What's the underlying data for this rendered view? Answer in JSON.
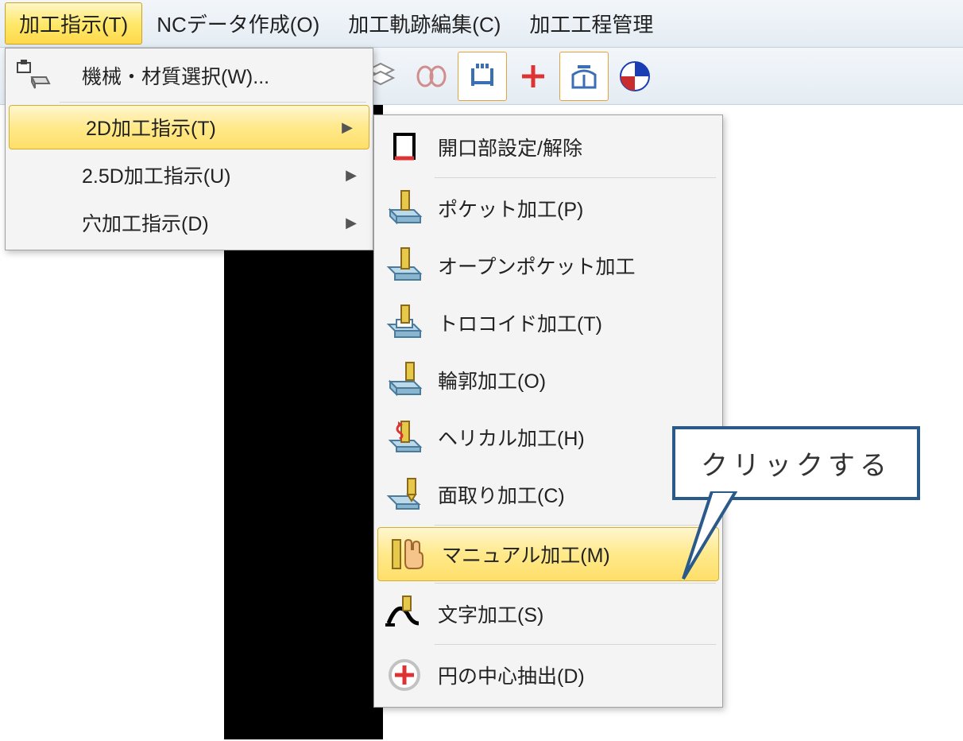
{
  "menubar": {
    "items": [
      {
        "label": "加工指示(T)",
        "accel": "T",
        "highlighted": true
      },
      {
        "label": "NCデータ作成(O)",
        "accel": "O"
      },
      {
        "label": "加工軌跡編集(C)",
        "accel": "C"
      },
      {
        "label": "加工工程管理",
        "accel": ""
      }
    ]
  },
  "toolbar": {
    "icons": [
      "layers",
      "coupling",
      "span-measure",
      "plus",
      "align-center",
      "target-bluered"
    ]
  },
  "dropdown": {
    "items": [
      {
        "label": "機械・材質選択(W)...",
        "accel": "W",
        "icon": "machine-material",
        "has_submenu": false
      },
      {
        "label": "2D加工指示(T)",
        "accel": "T",
        "icon": "",
        "has_submenu": true,
        "highlighted": true
      },
      {
        "label": "2.5D加工指示(U)",
        "accel": "U",
        "icon": "",
        "has_submenu": true
      },
      {
        "label": "穴加工指示(D)",
        "accel": "D",
        "icon": "",
        "has_submenu": true
      }
    ]
  },
  "submenu": {
    "items": [
      {
        "label": "開口部設定/解除",
        "accel": "",
        "icon": "opening"
      },
      {
        "label": "ポケット加工(P)",
        "accel": "P",
        "icon": "pocket"
      },
      {
        "label": "オープンポケット加工",
        "accel": "",
        "icon": "open-pocket"
      },
      {
        "label": "トロコイド加工(T)",
        "accel": "T",
        "icon": "trochoid"
      },
      {
        "label": "輪郭加工(O)",
        "accel": "O",
        "icon": "contour"
      },
      {
        "label": "ヘリカル加工(H)",
        "accel": "H",
        "icon": "helical"
      },
      {
        "label": "面取り加工(C)",
        "accel": "C",
        "icon": "chamfer"
      },
      {
        "label": "マニュアル加工(M)",
        "accel": "M",
        "icon": "manual",
        "highlighted": true
      },
      {
        "label": "文字加工(S)",
        "accel": "S",
        "icon": "text-engrave"
      },
      {
        "label": "円の中心抽出(D)",
        "accel": "D",
        "icon": "circle-center"
      }
    ]
  },
  "callout": {
    "text": "クリックする"
  }
}
